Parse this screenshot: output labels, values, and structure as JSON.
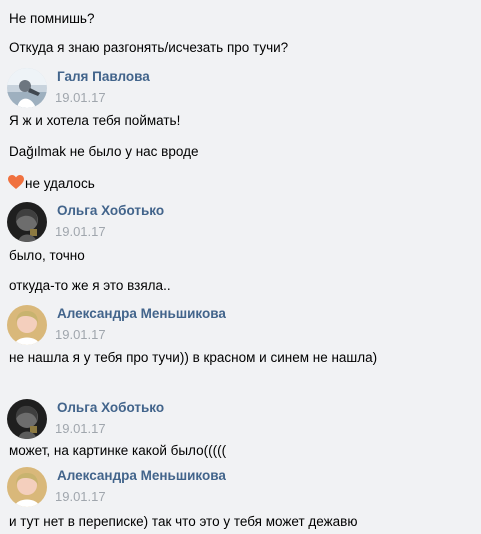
{
  "messages": [
    {
      "text": "Не помнишь?"
    },
    {
      "text": "Откуда я знаю разгонять/исчезать про тучи?"
    },
    {
      "author": "Галя Павлова",
      "date": "19.01.17",
      "avatar": "user-photo-1"
    },
    {
      "text": "Я ж и хотела тебя поймать!"
    },
    {
      "text": "Dağılmak не было у нас вроде"
    },
    {
      "text": "не удалось",
      "icon": "heart-icon",
      "icon_color": "#f0713f"
    },
    {
      "author": "Ольга Хоботько",
      "date": "19.01.17",
      "avatar": "user-photo-2"
    },
    {
      "text": "было, точно"
    },
    {
      "text": "откуда-то же я это взяла.."
    },
    {
      "author": "Александра Меньшикова",
      "date": "19.01.17",
      "avatar": "user-photo-3"
    },
    {
      "text": "не нашла я у тебя про тучи)) в красном и синем не нашла)"
    },
    {
      "author": "Ольга Хоботько",
      "date": "19.01.17",
      "avatar": "user-photo-2"
    },
    {
      "text": "может, на картинке какой было((((("
    },
    {
      "author": "Александра Меньшикова",
      "date": "19.01.17",
      "avatar": "user-photo-3"
    },
    {
      "text": "и тут нет в переписке) так что это у тебя может дежавю"
    }
  ],
  "colors": {
    "author": "#42648b",
    "date": "#a0a6ad",
    "background": "#f1f2f4",
    "text": "#000000"
  }
}
